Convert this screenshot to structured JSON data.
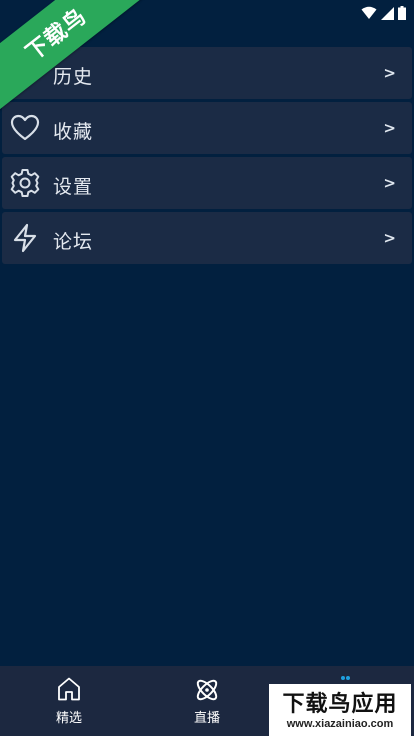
{
  "banner": {
    "text": "下载鸟"
  },
  "menu": {
    "items": [
      {
        "label": "历史",
        "icon": "history-icon",
        "chevron": ">"
      },
      {
        "label": "收藏",
        "icon": "heart-icon",
        "chevron": ">"
      },
      {
        "label": "设置",
        "icon": "gear-icon",
        "chevron": ">"
      },
      {
        "label": "论坛",
        "icon": "lightning-icon",
        "chevron": ">"
      }
    ]
  },
  "nav": {
    "tabs": [
      {
        "label": "精选",
        "icon": "home-icon"
      },
      {
        "label": "直播",
        "icon": "atom-icon"
      }
    ]
  },
  "watermark": {
    "title": "下载鸟应用",
    "url": "www.xiazainiao.com"
  },
  "colors": {
    "background": "#02203f",
    "card": "#1b2b45",
    "banner": "#2aa85a",
    "nav": "#1c2840"
  }
}
